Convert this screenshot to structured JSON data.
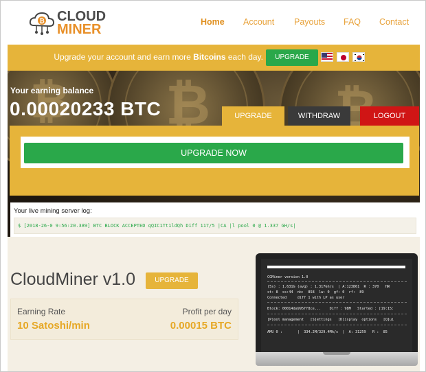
{
  "header": {
    "logo_line1": "CLOUD",
    "logo_line2": "MINER",
    "nav": [
      {
        "label": "Home",
        "active": true
      },
      {
        "label": "Account",
        "active": false
      },
      {
        "label": "Payouts",
        "active": false
      },
      {
        "label": "FAQ",
        "active": false
      },
      {
        "label": "Contact",
        "active": false
      }
    ]
  },
  "banner": {
    "text_before": "Upgrade your account and earn more ",
    "text_bold": "Bitcoins",
    "text_after": " each day.",
    "button": "UPGRADE",
    "flags": [
      "us-flag-icon",
      "japan-flag-icon",
      "korea-flag-icon"
    ]
  },
  "balance": {
    "label": "Your earning balance",
    "value": "0.00020233 BTC"
  },
  "tabs": {
    "upgrade": "UPGRADE",
    "withdraw": "WITHDRAW",
    "logout": "LOGOUT"
  },
  "upgrade_now": "UPGRADE NOW",
  "log": {
    "title": "Your live mining server log:",
    "line": "$ [2018-26-0 9:56:20.389] BTC BLOCK ACCEPTED qQIC1Tt1ldQh Diff 117/5 |CA |l pool 0 @ 1.337 GH/s|"
  },
  "product": {
    "title": "CloudMiner v1.0",
    "button": "UPGRADE",
    "earning_rate_label": "Earning Rate",
    "earning_rate_value": "10 Satoshi/min",
    "profit_label": "Profit per day",
    "profit_value": "0.00015 BTC"
  },
  "terminal": {
    "l1": "CGMiner version 1.0",
    "l2": "(5s) : 1.631G (avg) : 1.317Gh/s  | A:123861  R : 370   HW",
    "l3": "st: 8  ss:44  nb:  858  lw: 0  gf: 0  rf:  89",
    "l4": "Connected     diff 1 with LP as user",
    "l5": "Block: 00014da995ff8ce...    Diff : 98M   Started : [19:15:",
    "l6": "[P]ool management   [S]ettings   [D]isplay  options   [Q]ui",
    "l7": "AMU 0 :       |  334.2M/329.4Mh/s  |  A: 31259   R :  85"
  },
  "colors": {
    "accent_gold": "#e6b43a",
    "green": "#2aa84a",
    "red": "#d01515",
    "dark_tab": "#3a3a3a"
  }
}
